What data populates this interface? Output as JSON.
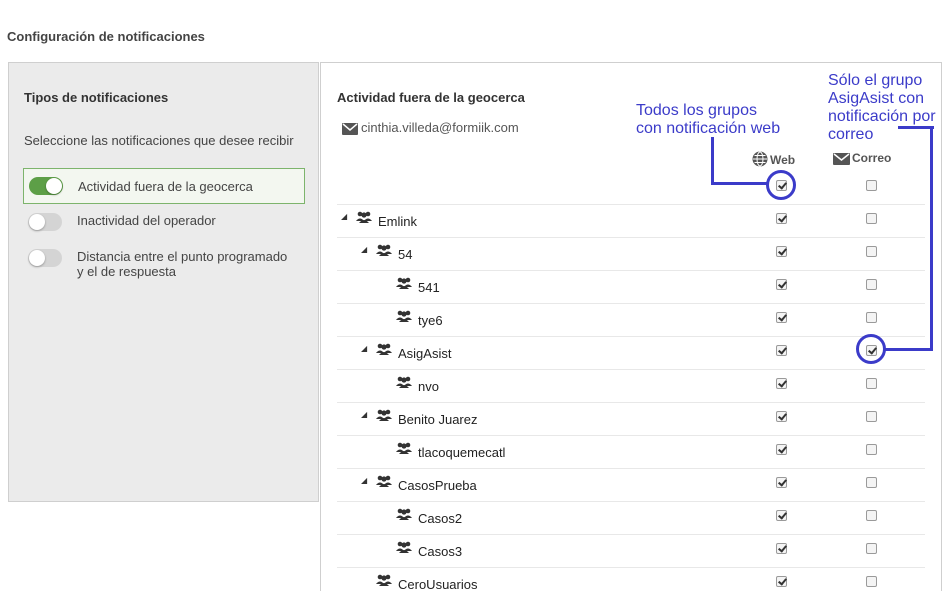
{
  "page": {
    "title": "Configuración de notificaciones"
  },
  "left": {
    "title": "Tipos de notificaciones",
    "subtitle": "Seleccione las notificaciones que desee recibir",
    "types": [
      {
        "label": "Actividad fuera de la geocerca",
        "enabled": true
      },
      {
        "label": "Inactividad del operador",
        "enabled": false
      },
      {
        "label": "Distancia entre el punto programado\ny el de respuesta",
        "enabled": false
      }
    ]
  },
  "right": {
    "title": "Actividad fuera de la geocerca",
    "email": "cinthia.villeda@formiik.com",
    "columns": {
      "web": "Web",
      "mail": "Correo"
    },
    "all": {
      "web": true,
      "mail": false
    },
    "rows": [
      {
        "name": "Emlink",
        "expander": "◢",
        "web": true,
        "mail": false
      },
      {
        "name": "54",
        "expander": "◢",
        "web": true,
        "mail": false
      },
      {
        "name": "541",
        "expander": "",
        "web": true,
        "mail": false
      },
      {
        "name": "tye6",
        "expander": "",
        "web": true,
        "mail": false
      },
      {
        "name": "AsigAsist",
        "expander": "◢",
        "web": true,
        "mail": true
      },
      {
        "name": "nvo",
        "expander": "",
        "web": true,
        "mail": false
      },
      {
        "name": "Benito Juarez",
        "expander": "◢",
        "web": true,
        "mail": false
      },
      {
        "name": "tlacoquemecatl",
        "expander": "",
        "web": true,
        "mail": false
      },
      {
        "name": "CasosPrueba",
        "expander": "◢",
        "web": true,
        "mail": false
      },
      {
        "name": "Casos2",
        "expander": "",
        "web": true,
        "mail": false
      },
      {
        "name": "Casos3",
        "expander": "",
        "web": true,
        "mail": false
      },
      {
        "name": "CeroUsuarios",
        "expander": "",
        "web": true,
        "mail": false
      }
    ]
  },
  "annotations": {
    "web_note": "Todos los grupos\ncon notificación web",
    "mail_note": "Sólo el grupo\nAsigAsist con\nnotificación por\ncorreo",
    "color": "#3b3bc9"
  },
  "colors": {
    "toggle_on": "#5d9f47",
    "toggle_off": "#d4d4d4",
    "panel_bg": "#ebebeb"
  }
}
